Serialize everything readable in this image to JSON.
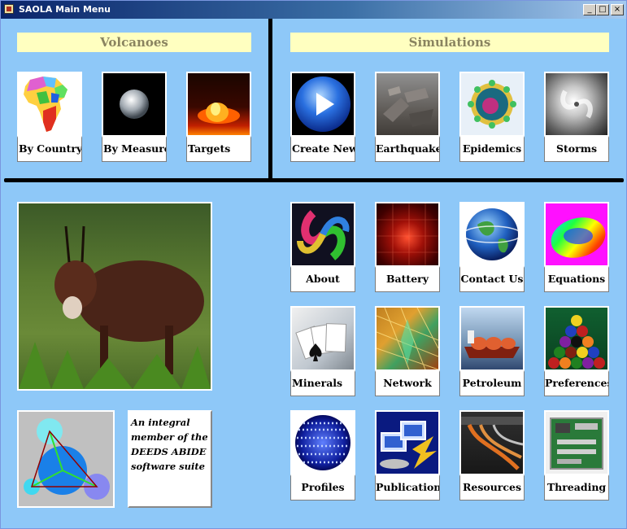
{
  "window": {
    "title": "SAOLA Main Menu",
    "minimize": "_",
    "maximize": "□",
    "close": "×"
  },
  "volcanoes": {
    "header": "Volcanoes",
    "items": [
      {
        "label": "By Country"
      },
      {
        "label": "By Measure"
      },
      {
        "label": "Targets"
      }
    ]
  },
  "simulations": {
    "header": "Simulations",
    "items": [
      {
        "label": "Create New"
      },
      {
        "label": "Earthquakes"
      },
      {
        "label": "Epidemics"
      },
      {
        "label": "Storms"
      }
    ]
  },
  "grid": {
    "items": [
      {
        "label": "About"
      },
      {
        "label": "Battery"
      },
      {
        "label": "Contact Us"
      },
      {
        "label": "Equations"
      },
      {
        "label": "Minerals"
      },
      {
        "label": "Network"
      },
      {
        "label": "Petroleum"
      },
      {
        "label": "Preferences"
      },
      {
        "label": "Profiles"
      },
      {
        "label": "Publications"
      },
      {
        "label": "Resources"
      },
      {
        "label": "Threading"
      }
    ]
  },
  "note": {
    "text": "An integral member of the DEEDS ABIDE software suite"
  }
}
